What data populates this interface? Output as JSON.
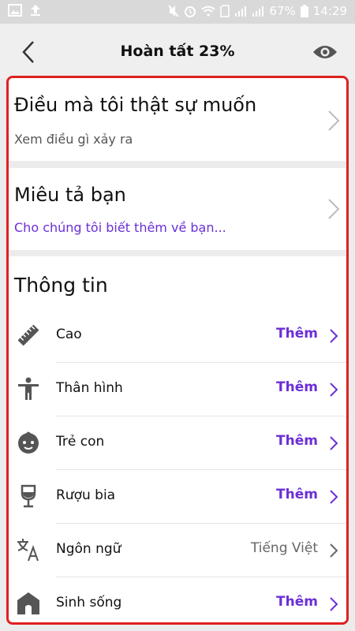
{
  "status_bar": {
    "battery": "67%",
    "time": "14:29"
  },
  "header": {
    "title": "Hoàn tất 23%"
  },
  "cards": [
    {
      "title": "Điều mà tôi thật sự muốn",
      "subtitle": "Xem điều gì xảy ra",
      "subtitle_color": "#555555"
    },
    {
      "title": "Miêu tả bạn",
      "subtitle": "Cho chúng tôi biết thêm về bạn...",
      "subtitle_color": "#6b2fd6"
    }
  ],
  "info": {
    "heading": "Thông tin",
    "rows": [
      {
        "icon": "ruler-icon",
        "label": "Cao",
        "value": "Thêm"
      },
      {
        "icon": "body-icon",
        "label": "Thân hình",
        "value": "Thêm"
      },
      {
        "icon": "baby-face-icon",
        "label": "Trẻ con",
        "value": "Thêm"
      },
      {
        "icon": "wine-glass-icon",
        "label": "Rượu bia",
        "value": "Thêm"
      },
      {
        "icon": "translate-icon",
        "label": "Ngôn ngữ",
        "value": "Tiếng Việt"
      },
      {
        "icon": "home-icon",
        "label": "Sinh sống",
        "value": "Thêm"
      }
    ]
  },
  "colors": {
    "accent": "#6b2fd6",
    "highlight_border": "#e02020"
  }
}
